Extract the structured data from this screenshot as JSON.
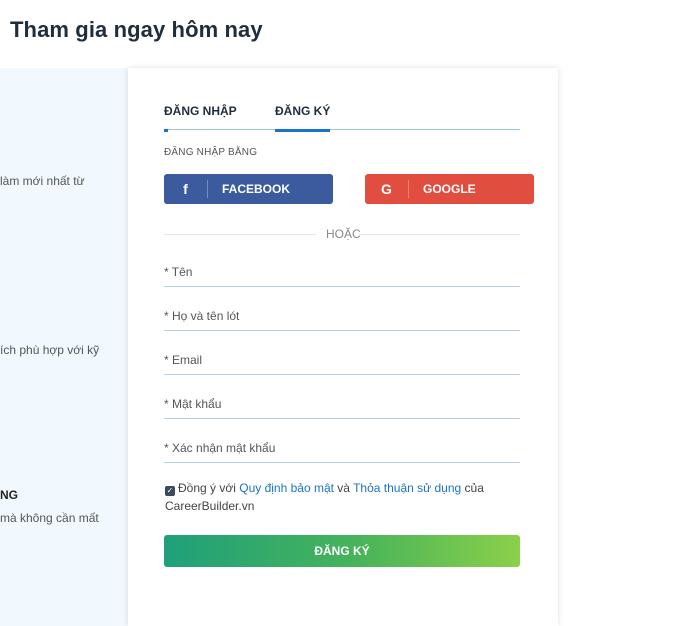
{
  "page": {
    "title": "Tham gia ngay hôm nay"
  },
  "left_panel": {
    "text1": "làm mới nhất từ",
    "text2": "ích phù hợp với kỹ",
    "text3": "NG",
    "text4": "mà không cần mất"
  },
  "tabs": {
    "login": "ĐĂNG NHẬP",
    "register": "ĐĂNG KÝ"
  },
  "social": {
    "label": "ĐĂNG NHẬP BẰNG",
    "facebook": {
      "icon": "f",
      "label": "FACEBOOK"
    },
    "google": {
      "icon": "G",
      "label": "GOOGLE"
    }
  },
  "divider": {
    "text": "HOẶC"
  },
  "form": {
    "first_name": {
      "placeholder": "* Tên",
      "value": ""
    },
    "last_name": {
      "placeholder": "* Họ và tên lót",
      "value": ""
    },
    "email": {
      "placeholder": "* Email",
      "value": ""
    },
    "password": {
      "placeholder": "* Mật khẩu",
      "value": ""
    },
    "confirm_password": {
      "placeholder": "* Xác nhận mật khẩu",
      "value": ""
    }
  },
  "agreement": {
    "checkmark": "✓",
    "prefix": "Đồng ý với ",
    "terms_link": "Quy định bảo mật",
    "middle": " và ",
    "agreement_link": "Thỏa thuận sử dụng",
    "suffix": " của",
    "site": "CareerBuilder.vn"
  },
  "submit": {
    "label": "ĐĂNG KÝ"
  },
  "colors": {
    "facebook": "#3b5b9e",
    "google": "#e14d3f",
    "accent": "#1a73c7",
    "submit_start": "#1fa07a",
    "submit_end": "#8bd04a"
  }
}
